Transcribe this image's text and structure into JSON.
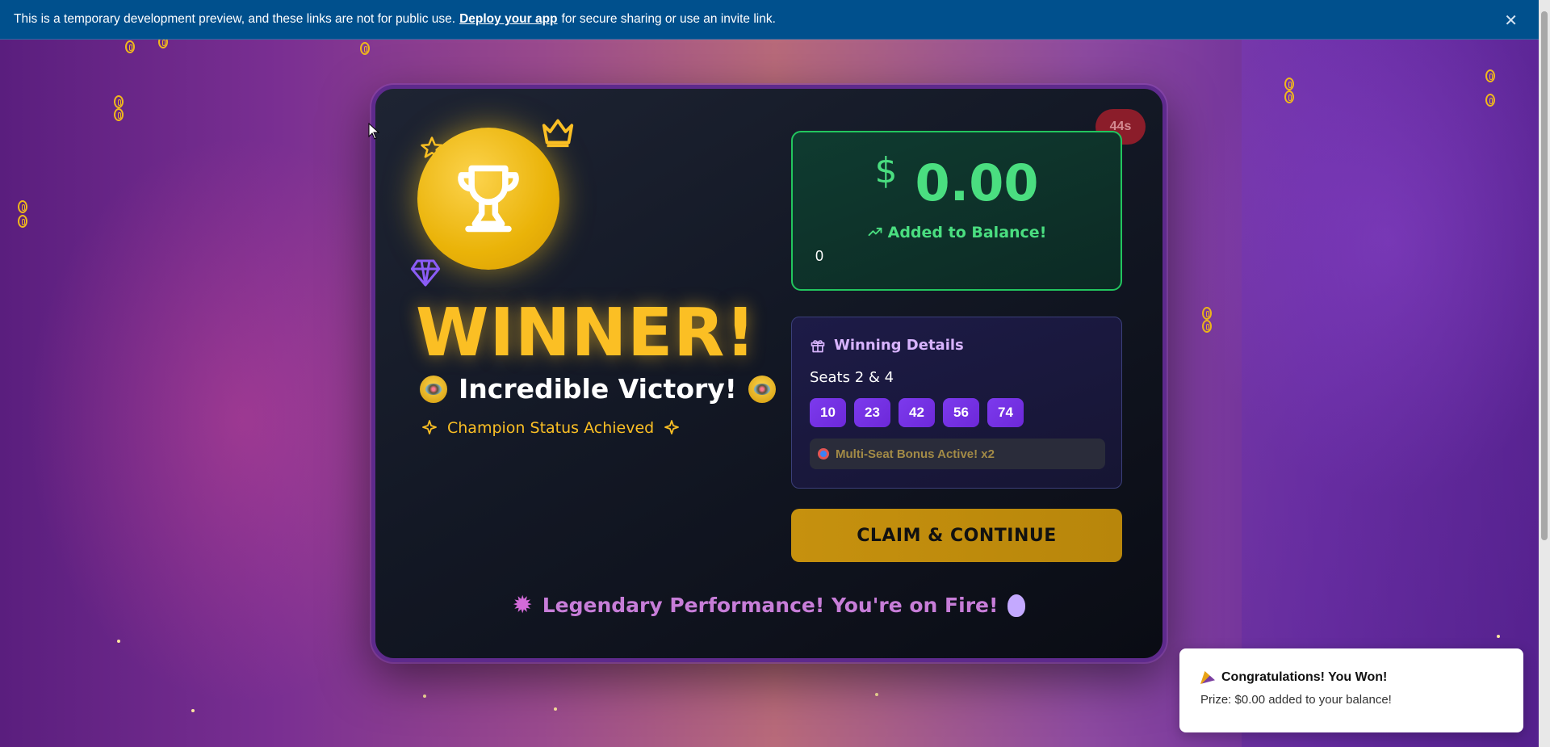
{
  "banner": {
    "text_before": "This is a temporary development preview, and these links are not for public use.",
    "link": "Deploy your app",
    "text_after": "for secure sharing or use an invite link.",
    "close_icon": "close-icon"
  },
  "colors": {
    "banner_bg": "#00508d",
    "gold": "#fbbf24",
    "green": "#4ade80",
    "purple_number": "#7c3aed",
    "card_border": "#5e2a8c"
  },
  "hero": {
    "title": "WINNER!",
    "subtitle": "Incredible Victory!",
    "status": "Champion Status Achieved",
    "icons": [
      "trophy-icon",
      "crown-icon",
      "star-icon",
      "gem-icon",
      "bee-icon",
      "sparkles-icon"
    ]
  },
  "timer": "44s",
  "balance": {
    "currency": "$",
    "amount": "0.00",
    "label": "Added to Balance!",
    "counter": "0"
  },
  "details": {
    "title": "Winning Details",
    "seats": "Seats 2 & 4",
    "numbers": [
      "10",
      "23",
      "42",
      "56",
      "74"
    ],
    "bonus": "Multi-Seat Bonus Active! x2"
  },
  "claim_button": "CLAIM & CONTINUE",
  "footer": "Legendary Performance! You're on Fire!",
  "toast": {
    "title": "Congratulations! You Won!",
    "body": "Prize: $0.00 added to your balance!"
  }
}
